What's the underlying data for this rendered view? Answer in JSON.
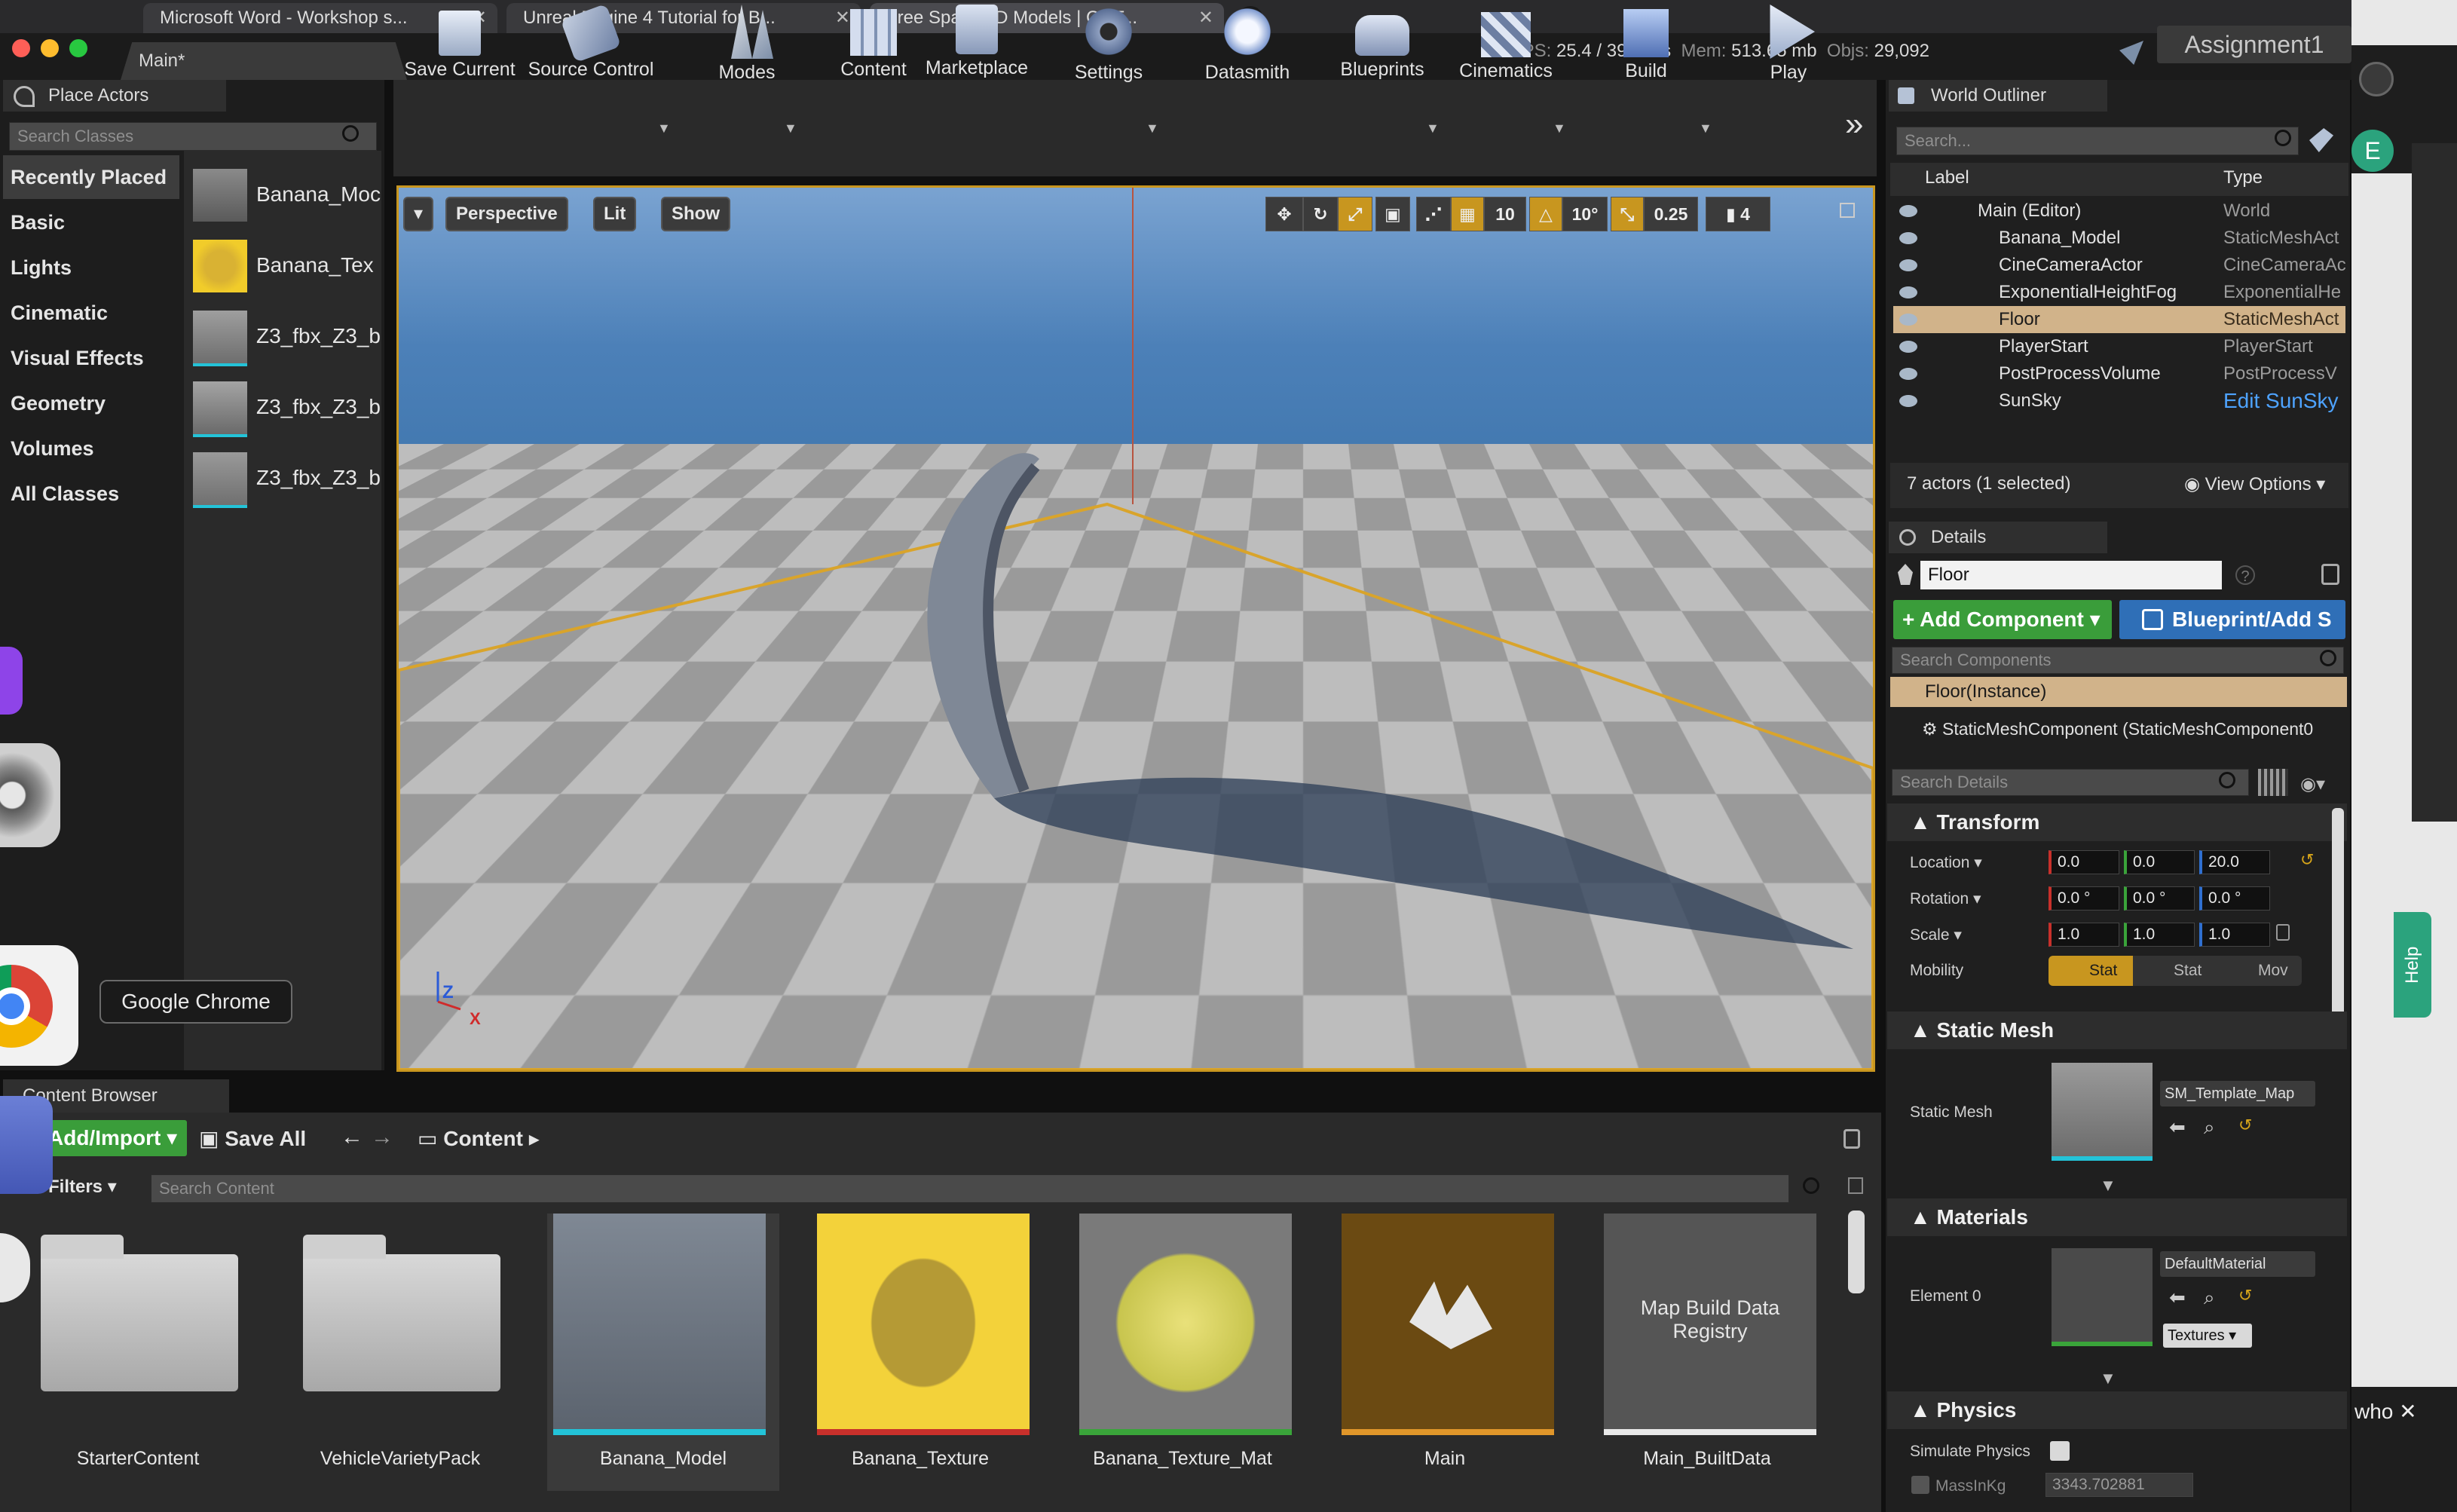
{
  "browser": {
    "tabs": [
      {
        "title": "Microsoft Word - Workshop s..."
      },
      {
        "title": "Unreal Engine 4 Tutorial for B..."
      },
      {
        "title": "Free Space 3D Models | CGT..."
      }
    ]
  },
  "editor": {
    "level_tab": "Main*",
    "project_name": "Assignment1",
    "stats": {
      "fps_label": "FPS:",
      "fps": "25.4",
      "ms": "/ 39.4 ms",
      "mem_label": "Mem:",
      "mem": "513.65 mb",
      "objs_label": "Objs:",
      "objs": "29,092"
    }
  },
  "place_actors": {
    "title": "Place Actors",
    "search_placeholder": "Search Classes",
    "categories": [
      "Recently Placed",
      "Basic",
      "Lights",
      "Cinematic",
      "Visual Effects",
      "Geometry",
      "Volumes",
      "All Classes"
    ],
    "selected_category": "Recently Placed",
    "assets": [
      "Banana_Moc",
      "Banana_Tex",
      "Z3_fbx_Z3_b",
      "Z3_fbx_Z3_b",
      "Z3_fbx_Z3_b"
    ]
  },
  "toolbar": {
    "items": [
      "Save Current",
      "Source Control",
      "Modes",
      "Content",
      "Marketplace",
      "Settings",
      "Datasmith",
      "Blueprints",
      "Cinematics",
      "Build",
      "Play"
    ],
    "overflow": "»"
  },
  "viewport": {
    "perspective": "Perspective",
    "lit": "Lit",
    "show": "Show",
    "grid_snap": "10",
    "rotation_snap": "10°",
    "scale_snap": "0.25",
    "camera_speed": "4",
    "axis": {
      "z": "Z",
      "x": "X"
    }
  },
  "world_outliner": {
    "title": "World Outliner",
    "search_placeholder": "Search...",
    "col_label": "Label",
    "col_type": "Type",
    "rows": [
      {
        "label": "Main (Editor)",
        "type": "World"
      },
      {
        "label": "Banana_Model",
        "type": "StaticMeshAct"
      },
      {
        "label": "CineCameraActor",
        "type": "CineCameraAc"
      },
      {
        "label": "ExponentialHeightFog",
        "type": "ExponentialHe"
      },
      {
        "label": "Floor",
        "type": "StaticMeshAct"
      },
      {
        "label": "PlayerStart",
        "type": "PlayerStart"
      },
      {
        "label": "PostProcessVolume",
        "type": "PostProcessV"
      },
      {
        "label": "SunSky",
        "type": "Edit SunSky"
      }
    ],
    "selected": "Floor",
    "footer": "7 actors (1 selected)",
    "view_options": "View Options"
  },
  "details": {
    "title": "Details",
    "name_value": "Floor",
    "add_component": "+ Add Component",
    "blueprint": "Blueprint/Add S",
    "search_components": "Search Components",
    "instance": "Floor(Instance)",
    "component": "StaticMeshComponent (StaticMeshComponent0",
    "search_details": "Search Details",
    "transform": {
      "title": "Transform",
      "location_label": "Location",
      "location": [
        "0.0",
        "0.0",
        "20.0"
      ],
      "rotation_label": "Rotation",
      "rotation": [
        "0.0 °",
        "0.0 °",
        "0.0 °"
      ],
      "scale_label": "Scale",
      "scale": [
        "1.0",
        "1.0",
        "1.0"
      ],
      "mobility_label": "Mobility",
      "mobility": [
        "Stat",
        "Stat",
        "Mov"
      ]
    },
    "static_mesh": {
      "title": "Static Mesh",
      "label": "Static Mesh",
      "value": "SM_Template_Map"
    },
    "materials": {
      "title": "Materials",
      "label": "Element 0",
      "value": "DefaultMaterial",
      "textures": "Textures"
    },
    "physics": {
      "title": "Physics",
      "simulate": "Simulate Physics",
      "mass_label": "MassInKg",
      "mass_value": "3343.702881"
    }
  },
  "content_browser": {
    "title": "Content Browser",
    "add_import": "Add/Import",
    "save_all": "Save All",
    "path": "Content",
    "filters": "Filters",
    "search_placeholder": "Search Content",
    "items": [
      {
        "label": "StarterContent",
        "kind": "folder"
      },
      {
        "label": "VehicleVarietyPack",
        "kind": "folder"
      },
      {
        "label": "Banana_Model",
        "kind": "mesh"
      },
      {
        "label": "Banana_Texture",
        "kind": "texture"
      },
      {
        "label": "Banana_Texture_Mat",
        "kind": "material"
      },
      {
        "label": "Main",
        "kind": "level"
      },
      {
        "label": "Main_BuiltData",
        "kind": "data",
        "thumb_text": "Map Build Data Registry"
      }
    ]
  },
  "desktop": {
    "tooltip": "Google Chrome",
    "help": "Help",
    "who": "who ✕",
    "avatar": "E"
  },
  "colors": {
    "accent": "#c8961f",
    "selection": "#d1b38a",
    "add_component": "#3a9d3a",
    "blueprint": "#2f6fb7",
    "link": "#4ea3ff"
  }
}
